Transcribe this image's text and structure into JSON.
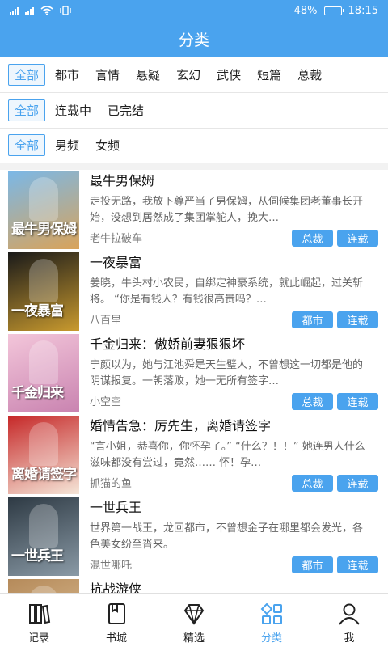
{
  "status_bar": {
    "signal_left": "⁴⁶",
    "signal_right": "⁴⁶",
    "battery_percent": "48%",
    "battery_level": 0.48,
    "time": "18:15"
  },
  "header": {
    "title": "分类"
  },
  "filters": {
    "row1": [
      "全部",
      "都市",
      "言情",
      "悬疑",
      "玄幻",
      "武侠",
      "短篇",
      "总裁"
    ],
    "row2": [
      "全部",
      "连载中",
      "已完结"
    ],
    "row3": [
      "全部",
      "男频",
      "女频"
    ]
  },
  "books": [
    {
      "title": "最牛男保姆",
      "desc": "走投无路，我放下尊严当了男保姆，从伺候集团老董事长开始，没想到居然成了集团掌舵人，挽大…",
      "author": "老牛拉破车",
      "tags": [
        "总裁",
        "连载"
      ],
      "cover_text": "最牛男保姆",
      "cover_colors": [
        "#7ab8e8",
        "#d9a35a"
      ]
    },
    {
      "title": "一夜暴富",
      "desc": "姜晓，牛头村小农民，自绑定神豪系统，就此崛起，过关斩将。 “你是有钱人？有钱很高贵吗？…",
      "author": "八百里",
      "tags": [
        "都市",
        "连载"
      ],
      "cover_text": "一夜暴富",
      "cover_colors": [
        "#1a1a1a",
        "#c99a2e"
      ]
    },
    {
      "title": "千金归来：傲娇前妻狠狠坏",
      "desc": "宁颜以为，她与江池舜是天生璧人，不曾想这一切都是他的阴谋报复。一朝落败，她一无所有签字…",
      "author": "小空空",
      "tags": [
        "总裁",
        "连载"
      ],
      "cover_text": "千金归来",
      "cover_colors": [
        "#f3c6da",
        "#c983b0"
      ]
    },
    {
      "title": "婚情告急：厉先生，离婚请签字",
      "desc": "“言小姐，恭喜你，你怀孕了。” “什么？！！” 她连男人什么滋味都没有尝过，竟然…… 怀！孕…",
      "author": "抓猫的鱼",
      "tags": [
        "总裁",
        "连载"
      ],
      "cover_text": "离婚请签字",
      "cover_colors": [
        "#c62828",
        "#f5e6d8"
      ]
    },
    {
      "title": "一世兵王",
      "desc": "世界第一战王，龙回都市，不曾想金子在哪里都会发光，各色美女纷至沓来。",
      "author": "混世哪吒",
      "tags": [
        "都市",
        "连载"
      ],
      "cover_text": "一世兵王",
      "cover_colors": [
        "#2e3a44",
        "#8a9aa6"
      ]
    },
    {
      "title": "抗战游侠",
      "desc": "",
      "author": "",
      "tags": [],
      "cover_text": "",
      "cover_colors": [
        "#b58a5a",
        "#e3c9a0"
      ]
    }
  ],
  "bottom_nav": [
    {
      "label": "记录",
      "icon": "books-icon",
      "active": false
    },
    {
      "label": "书城",
      "icon": "bookmark-book-icon",
      "active": false
    },
    {
      "label": "精选",
      "icon": "diamond-icon",
      "active": false
    },
    {
      "label": "分类",
      "icon": "grid-category-icon",
      "active": true
    },
    {
      "label": "我",
      "icon": "person-icon",
      "active": false
    }
  ],
  "colors": {
    "accent": "#4aa3ee",
    "tag_bg": "#4aa3ee",
    "divider": "#e6e6e6"
  }
}
